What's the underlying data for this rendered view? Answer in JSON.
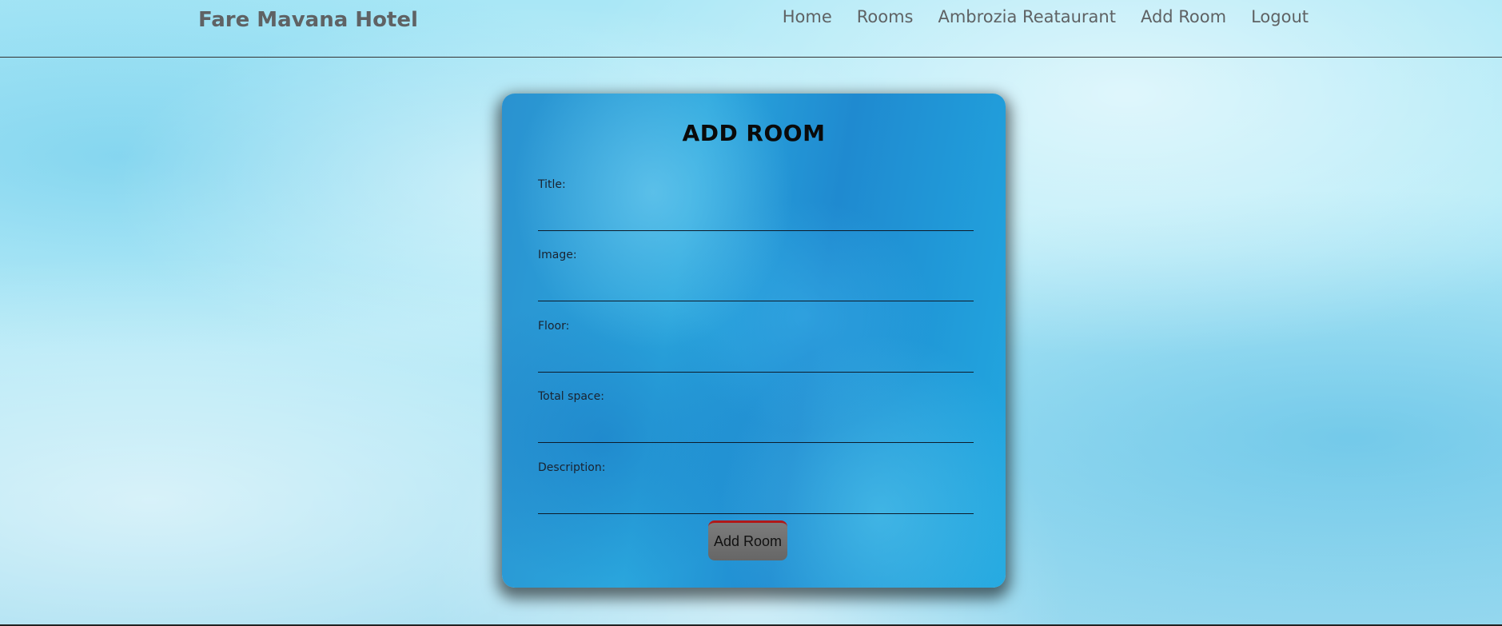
{
  "header": {
    "brand": "Fare Mavana Hotel",
    "nav": [
      "Home",
      "Rooms",
      "Ambrozia Reataurant",
      "Add Room",
      "Logout"
    ]
  },
  "form": {
    "title": "ADD ROOM",
    "fields": [
      {
        "label": "Title:",
        "value": ""
      },
      {
        "label": "Image:",
        "value": ""
      },
      {
        "label": "Floor:",
        "value": ""
      },
      {
        "label": "Total space:",
        "value": ""
      },
      {
        "label": "Description:",
        "value": ""
      }
    ],
    "submit_label": "Add Room"
  },
  "colors": {
    "brand_text": "#5f6264",
    "card_blue": "#2aa6dd",
    "button_gray": "#707070",
    "button_accent": "#b01818"
  }
}
